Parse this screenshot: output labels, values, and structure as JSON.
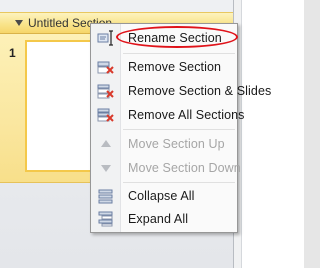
{
  "section": {
    "title": "Untitled Section"
  },
  "slide": {
    "number": "1"
  },
  "context_menu": {
    "items": [
      {
        "label": "Rename Section",
        "icon": "rename-icon",
        "enabled": true
      },
      {
        "label": "Remove Section",
        "icon": "remove-section-icon",
        "enabled": true
      },
      {
        "label": "Remove Section & Slides",
        "icon": "remove-section-slides-icon",
        "enabled": true
      },
      {
        "label": "Remove All Sections",
        "icon": "remove-all-sections-icon",
        "enabled": true
      },
      {
        "label": "Move Section Up",
        "icon": "move-up-icon",
        "enabled": false
      },
      {
        "label": "Move Section Down",
        "icon": "move-down-icon",
        "enabled": false
      },
      {
        "label": "Collapse All",
        "icon": "collapse-all-icon",
        "enabled": true
      },
      {
        "label": "Expand All",
        "icon": "expand-all-icon",
        "enabled": true
      }
    ]
  },
  "colors": {
    "highlight_oval": "#e0131a",
    "selection": "#f9e48c",
    "remove_x": "#d93a2b"
  }
}
